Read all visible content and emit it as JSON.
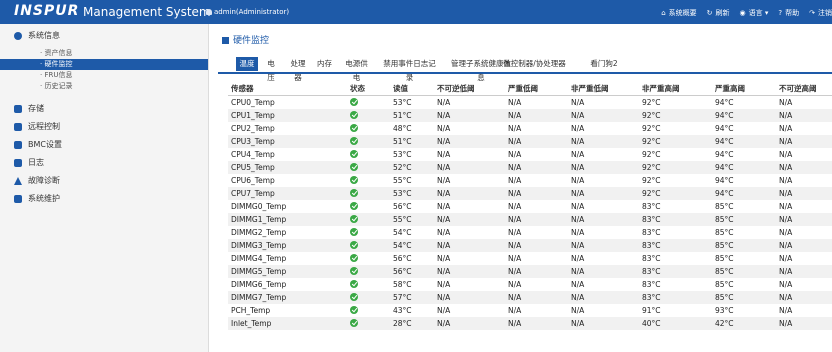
{
  "header": {
    "brand": "INSPUR",
    "title": "Management System",
    "user": "admin(Administrator)",
    "nav": [
      {
        "icon": "home-icon",
        "glyph": "⌂",
        "label": "系统概要"
      },
      {
        "icon": "refresh-icon",
        "glyph": "↻",
        "label": "刷新"
      },
      {
        "icon": "language-icon",
        "glyph": "◉",
        "label": "语言 ▾"
      },
      {
        "icon": "help-icon",
        "glyph": "?",
        "label": "帮助"
      },
      {
        "icon": "logout-icon",
        "glyph": "↷",
        "label": "注销"
      }
    ]
  },
  "sidebar": {
    "groups": [
      {
        "label": "系统信息",
        "icon": "info-icon",
        "color": "#1e5aa8"
      },
      {
        "label": "存储",
        "icon": "storage-icon",
        "color": "#1e5aa8"
      },
      {
        "label": "远程控制",
        "icon": "remote-control-icon",
        "color": "#1e5aa8"
      },
      {
        "label": "BMC设置",
        "icon": "gear-icon",
        "color": "#1e5aa8"
      },
      {
        "label": "日志",
        "icon": "log-icon",
        "color": "#1e5aa8"
      },
      {
        "label": "故障诊断",
        "icon": "warning-icon",
        "color": "#1e5aa8"
      },
      {
        "label": "系统维护",
        "icon": "maintenance-icon",
        "color": "#1e5aa8"
      }
    ],
    "subitems": [
      {
        "label": "· 资产信息"
      },
      {
        "label": "· 硬件监控"
      },
      {
        "label": "· FRU信息"
      },
      {
        "label": "· 历史记录"
      }
    ]
  },
  "breadcrumb": "硬件监控",
  "tabs": [
    "温度",
    "电压",
    "处理器",
    "内存",
    "电源供电",
    "禁用事件日志记录",
    "管理子系统健康信息",
    "微控制器/协处理器",
    "看门狗2"
  ],
  "active_tab": 0,
  "table": {
    "columns": [
      "传感器",
      "状态",
      "读值",
      "不可逆低阈",
      "严重低阈",
      "非严重低阈",
      "非严重高阈",
      "严重高阈",
      "不可逆高阈"
    ],
    "status_ok_color": "#3aa845",
    "rows": [
      [
        "CPU0_Temp",
        "ok",
        "53°C",
        "N/A",
        "N/A",
        "N/A",
        "92°C",
        "94°C",
        "N/A"
      ],
      [
        "CPU1_Temp",
        "ok",
        "51°C",
        "N/A",
        "N/A",
        "N/A",
        "92°C",
        "94°C",
        "N/A"
      ],
      [
        "CPU2_Temp",
        "ok",
        "48°C",
        "N/A",
        "N/A",
        "N/A",
        "92°C",
        "94°C",
        "N/A"
      ],
      [
        "CPU3_Temp",
        "ok",
        "51°C",
        "N/A",
        "N/A",
        "N/A",
        "92°C",
        "94°C",
        "N/A"
      ],
      [
        "CPU4_Temp",
        "ok",
        "53°C",
        "N/A",
        "N/A",
        "N/A",
        "92°C",
        "94°C",
        "N/A"
      ],
      [
        "CPU5_Temp",
        "ok",
        "52°C",
        "N/A",
        "N/A",
        "N/A",
        "92°C",
        "94°C",
        "N/A"
      ],
      [
        "CPU6_Temp",
        "ok",
        "55°C",
        "N/A",
        "N/A",
        "N/A",
        "92°C",
        "94°C",
        "N/A"
      ],
      [
        "CPU7_Temp",
        "ok",
        "53°C",
        "N/A",
        "N/A",
        "N/A",
        "92°C",
        "94°C",
        "N/A"
      ],
      [
        "DIMMG0_Temp",
        "ok",
        "56°C",
        "N/A",
        "N/A",
        "N/A",
        "83°C",
        "85°C",
        "N/A"
      ],
      [
        "DIMMG1_Temp",
        "ok",
        "55°C",
        "N/A",
        "N/A",
        "N/A",
        "83°C",
        "85°C",
        "N/A"
      ],
      [
        "DIMMG2_Temp",
        "ok",
        "54°C",
        "N/A",
        "N/A",
        "N/A",
        "83°C",
        "85°C",
        "N/A"
      ],
      [
        "DIMMG3_Temp",
        "ok",
        "54°C",
        "N/A",
        "N/A",
        "N/A",
        "83°C",
        "85°C",
        "N/A"
      ],
      [
        "DIMMG4_Temp",
        "ok",
        "56°C",
        "N/A",
        "N/A",
        "N/A",
        "83°C",
        "85°C",
        "N/A"
      ],
      [
        "DIMMG5_Temp",
        "ok",
        "56°C",
        "N/A",
        "N/A",
        "N/A",
        "83°C",
        "85°C",
        "N/A"
      ],
      [
        "DIMMG6_Temp",
        "ok",
        "58°C",
        "N/A",
        "N/A",
        "N/A",
        "83°C",
        "85°C",
        "N/A"
      ],
      [
        "DIMMG7_Temp",
        "ok",
        "57°C",
        "N/A",
        "N/A",
        "N/A",
        "83°C",
        "85°C",
        "N/A"
      ],
      [
        "PCH_Temp",
        "ok",
        "43°C",
        "N/A",
        "N/A",
        "N/A",
        "91°C",
        "93°C",
        "N/A"
      ],
      [
        "Inlet_Temp",
        "ok",
        "28°C",
        "N/A",
        "N/A",
        "N/A",
        "40°C",
        "42°C",
        "N/A"
      ]
    ]
  }
}
